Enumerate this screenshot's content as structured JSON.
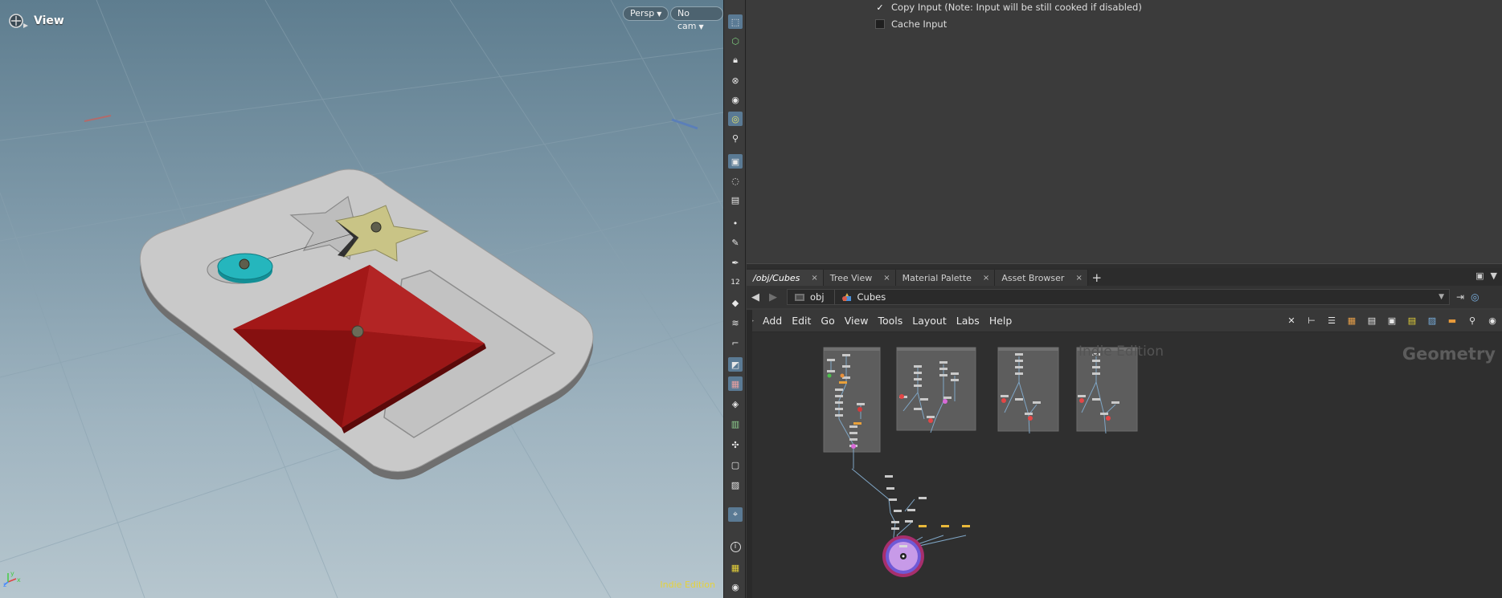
{
  "viewport": {
    "title": "View",
    "camera_view": "Persp",
    "camera_select": "No cam",
    "edition_label": "Indie Edition",
    "axis_labels": [
      "x",
      "y",
      "z"
    ]
  },
  "shelf": {
    "tools": [
      {
        "icon": "select-icon",
        "on": true
      },
      {
        "icon": "geometry-select-icon",
        "on": false
      },
      {
        "icon": "lock-icon",
        "on": false
      },
      {
        "icon": "ghost-icon",
        "on": false
      },
      {
        "icon": "sphere-shade-icon",
        "on": false
      },
      {
        "icon": "snap-icon",
        "on": true
      },
      {
        "icon": "camera-pin-icon",
        "on": false
      },
      {
        "icon": "light-view-icon",
        "on": true
      },
      {
        "icon": "visualizer-icon",
        "on": false
      },
      {
        "icon": "camera-icon",
        "on": false
      },
      {
        "icon": "point-icon",
        "on": false
      },
      {
        "icon": "brush-icon",
        "on": false
      },
      {
        "icon": "pen-icon",
        "on": false
      },
      {
        "icon": "number-icon",
        "on": false
      },
      {
        "icon": "tag-icon",
        "on": false
      },
      {
        "icon": "stack-icon",
        "on": false
      },
      {
        "icon": "corner-icon",
        "on": false
      },
      {
        "icon": "shade-icon",
        "on": true
      },
      {
        "icon": "texture-icon",
        "on": true
      },
      {
        "icon": "diamond-icon",
        "on": false
      },
      {
        "icon": "film-icon",
        "on": false
      },
      {
        "icon": "transform-icon",
        "on": false
      },
      {
        "icon": "display-icon",
        "on": false
      },
      {
        "icon": "image-icon",
        "on": false
      },
      {
        "icon": "location-icon",
        "on": true
      },
      {
        "icon": "info-icon",
        "on": false
      },
      {
        "icon": "grid-layout-icon",
        "on": false
      },
      {
        "icon": "eye-icon",
        "on": false
      }
    ],
    "number_label": "12",
    "info_label": "i"
  },
  "params": {
    "copy_input": {
      "label": "Copy Input (Note: Input will be still cooked if disabled)",
      "checked": true
    },
    "cache_input": {
      "label": "Cache Input",
      "checked": false
    }
  },
  "tabs": [
    {
      "label": "/obj/Cubes",
      "active": true
    },
    {
      "label": "Tree View",
      "active": false
    },
    {
      "label": "Material Palette",
      "active": false
    },
    {
      "label": "Asset Browser",
      "active": false
    }
  ],
  "tab_add": "+",
  "tab_close": "×",
  "path": {
    "crumbs": [
      {
        "label": "obj",
        "icon": "obj-icon"
      },
      {
        "label": "Cubes",
        "icon": "geometry-icon"
      }
    ]
  },
  "menu": {
    "items": [
      "Add",
      "Edit",
      "Go",
      "View",
      "Tools",
      "Layout",
      "Labs",
      "Help"
    ]
  },
  "network": {
    "watermark": "Indie Edition",
    "context": "Geometry"
  }
}
